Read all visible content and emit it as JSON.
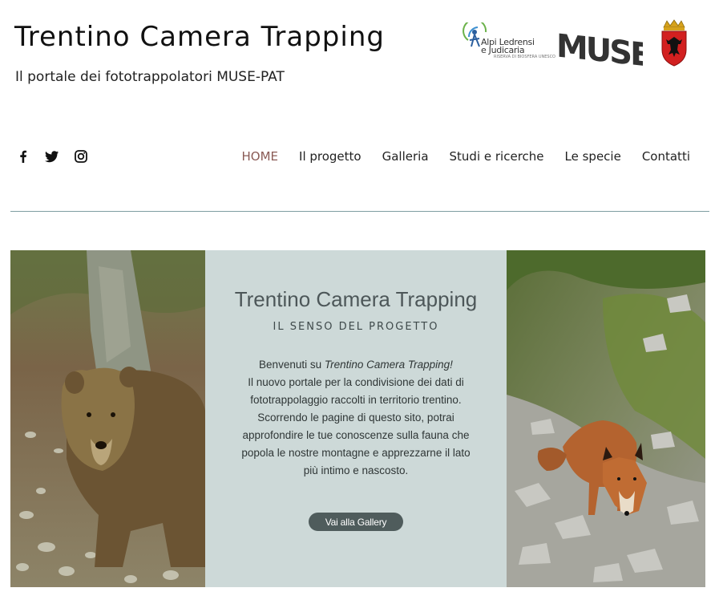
{
  "header": {
    "title": "Trentino Camera Trapping",
    "subtitle": "Il portale dei fototrappolatori MUSE-PAT"
  },
  "logos": {
    "alpi_line1": "Alpi Ledrensi",
    "alpi_line2": "e Judicaria",
    "alpi_small": "RISERVA DI BIOSFERA UNESCO",
    "muse": "MUSE"
  },
  "social": [
    "facebook-icon",
    "twitter-icon",
    "instagram-icon"
  ],
  "nav": {
    "items": [
      {
        "label": "HOME",
        "active": true
      },
      {
        "label": "Il progetto"
      },
      {
        "label": "Galleria"
      },
      {
        "label": "Studi e ricerche"
      },
      {
        "label": "Le specie"
      },
      {
        "label": "Contatti"
      }
    ]
  },
  "hero": {
    "title": "Trentino Camera Trapping",
    "kicker": "IL SENSO DEL PROGETTO",
    "intro": "Benvenuti su ",
    "intro_em": "Trentino Camera Trapping!",
    "body": "Il nuovo portale per la condivisione dei dati di fototrappolaggio raccolti in territorio trentino. Scorrendo le pagine di questo sito, potrai approfondire le tue conoscenze sulla fauna che popola le nostre montagne e apprezzarne il lato più intimo e nascosto.",
    "cta_label": "Vai alla Gallery"
  },
  "colors": {
    "panel_bg": "#cdd9d8",
    "nav_active": "#8a5a55",
    "cta_bg": "#4f5c5c",
    "rule": "#7f9ea2"
  }
}
